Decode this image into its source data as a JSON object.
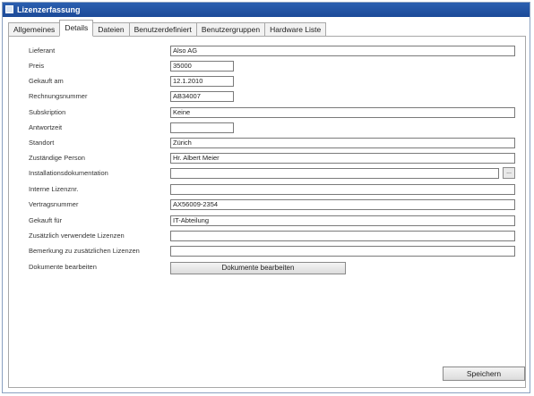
{
  "window": {
    "title": "Lizenzerfassung"
  },
  "tabs": [
    "Allgemeines",
    "Details",
    "Dateien",
    "Benutzerdefiniert",
    "Benutzergruppen",
    "Hardware Liste"
  ],
  "fields": {
    "lieferant": {
      "label": "Lieferant",
      "value": "Also AG"
    },
    "preis": {
      "label": "Preis",
      "value": "35000"
    },
    "gekauft_am": {
      "label": "Gekauft am",
      "value": "12.1.2010"
    },
    "rechnungsnummer": {
      "label": "Rechnungsnummer",
      "value": "AB34007"
    },
    "subskription": {
      "label": "Subskription",
      "value": "Keine"
    },
    "antwortzeit": {
      "label": "Antwortzeit",
      "value": ""
    },
    "standort": {
      "label": "Standort",
      "value": "Zürich"
    },
    "zustaendige_person": {
      "label": "Zuständige Person",
      "value": "Hr. Albert Meier"
    },
    "installationsdokumentation": {
      "label": "Installationsdokumentation",
      "value": "",
      "browse_label": "..."
    },
    "interne_lizenznr": {
      "label": "Interne Lizenznr.",
      "value": ""
    },
    "vertragsnummer": {
      "label": "Vertragsnummer",
      "value": "AX56009-2354"
    },
    "gekauft_fuer": {
      "label": "Gekauft für",
      "value": "IT-Abteilung"
    },
    "zusaetzlich_lizenzen": {
      "label": "Zusätzlich verwendete Lizenzen",
      "value": ""
    },
    "bemerkung": {
      "label": "Bemerkung zu zusätzlichen Lizenzen",
      "value": ""
    },
    "dokumente": {
      "label": "Dokumente bearbeiten",
      "button_label": "Dokumente bearbeiten"
    }
  },
  "actions": {
    "save_label": "Speichern"
  }
}
